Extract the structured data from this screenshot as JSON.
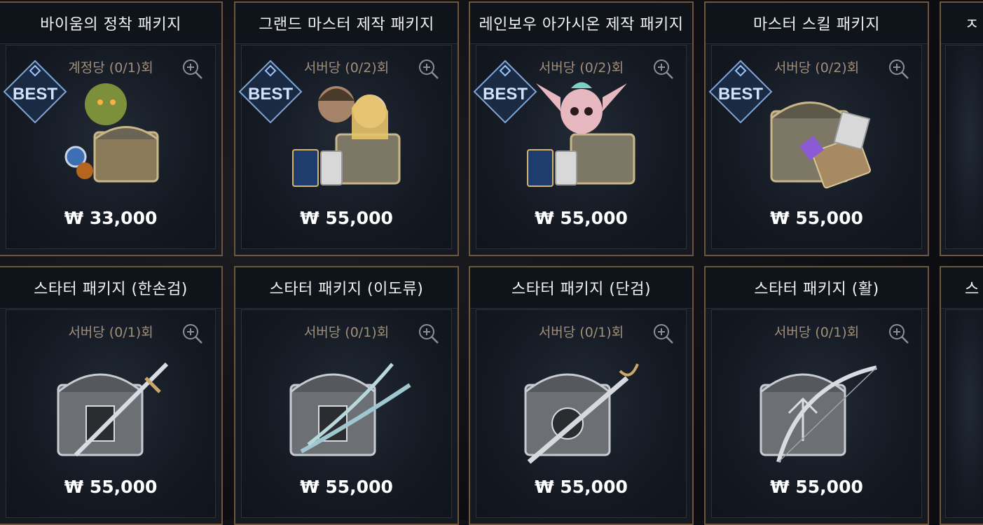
{
  "currency_symbol": "₩",
  "best_badge": "BEST",
  "row1": [
    {
      "title": "바이움의 정착 패키지",
      "limit": "계정당 (0/1)회",
      "price": "₩ 33,000",
      "best": true,
      "art": "orc-pet-chest"
    },
    {
      "title": "그랜드 마스터 제작 패키지",
      "limit": "서버당 (0/2)회",
      "price": "₩ 55,000",
      "best": true,
      "art": "heroes-chest"
    },
    {
      "title": "레인보우 아가시온 제작 패키지",
      "limit": "서버당 (0/2)회",
      "price": "₩ 55,000",
      "best": true,
      "art": "pet-chest"
    },
    {
      "title": "마스터 스킬 패키지",
      "limit": "서버당 (0/2)회",
      "price": "₩ 55,000",
      "best": true,
      "art": "skillbook-chest"
    }
  ],
  "row2": [
    {
      "title": "스타터 패키지 (한손검)",
      "limit": "서버당 (0/1)회",
      "price": "₩ 55,000",
      "best": false,
      "art": "sword-chest"
    },
    {
      "title": "스타터 패키지 (이도류)",
      "limit": "서버당 (0/1)회",
      "price": "₩ 55,000",
      "best": false,
      "art": "dualblade-chest"
    },
    {
      "title": "스타터 패키지 (단검)",
      "limit": "서버당 (0/1)회",
      "price": "₩ 55,000",
      "best": false,
      "art": "dagger-chest"
    },
    {
      "title": "스타터 패키지 (활)",
      "limit": "서버당 (0/1)회",
      "price": "₩ 55,000",
      "best": false,
      "art": "bow-chest"
    }
  ],
  "partial_cards": {
    "top_title": "ㅈ",
    "bottom_title": "스"
  },
  "colors": {
    "border": "#6e563a",
    "limit_text": "#a08f79",
    "badge": "#9ec3ff"
  }
}
